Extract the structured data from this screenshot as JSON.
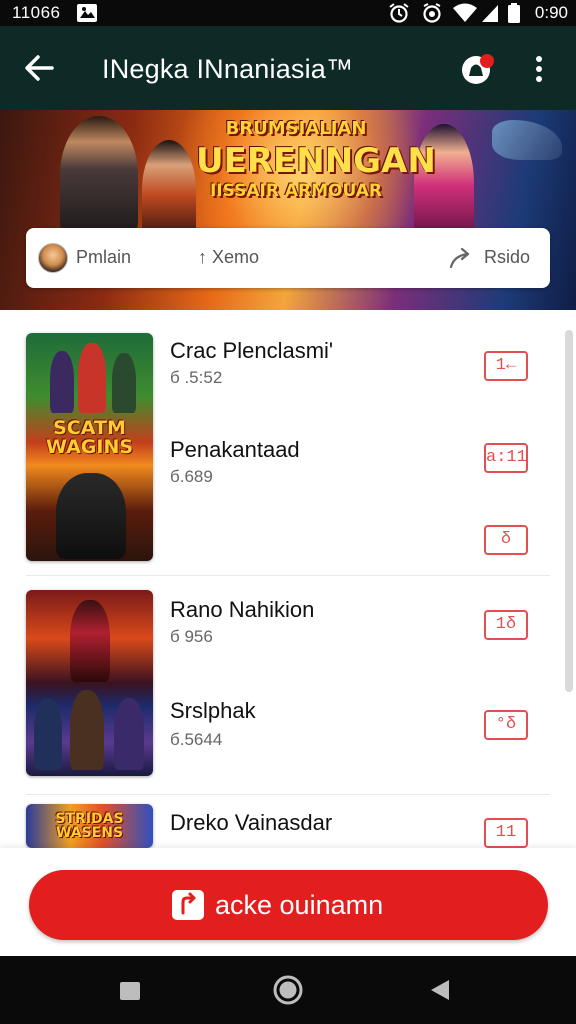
{
  "status_bar": {
    "time": "11066",
    "clock": "0:90"
  },
  "app_bar": {
    "title": "INegka INnaniasia™",
    "icons": [
      "back-arrow-icon",
      "notification-badge-icon",
      "more-vert-icon"
    ]
  },
  "banner": {
    "line1": "BRUMSIALIAN",
    "line2": "UERENNGAN",
    "line3": "IISSAIR ARMOUAR",
    "share_bar": {
      "label_1": "Pmlain",
      "label_2": "↑ Xemo",
      "label_3": "Rsido"
    }
  },
  "groups": [
    {
      "thumb_text": "SCATM WAGINS",
      "items": [
        {
          "title": "Crac Plenclasmi'",
          "meta": "б .5:52",
          "action": "1←"
        },
        {
          "title": "Penakantaad",
          "meta": "б.689",
          "action": "а:11"
        },
        {
          "title": "",
          "meta": "",
          "action": "δ"
        }
      ]
    },
    {
      "thumb_text": "",
      "items": [
        {
          "title": "Rano Nahikion",
          "meta": "б 956",
          "action": "1δ"
        },
        {
          "title": "Srslphak",
          "meta": "б.5644",
          "action": "°δ"
        }
      ]
    },
    {
      "thumb_text": "STRIDAS WASENS",
      "items": [
        {
          "title": "Dreko Vainasdar",
          "meta": "",
          "action": "11"
        }
      ]
    }
  ],
  "cta": {
    "label": "acke ouinamn"
  },
  "colors": {
    "app_bar": "#0d2a27",
    "accent_red": "#e31e1e",
    "action_outline": "#e05050"
  }
}
